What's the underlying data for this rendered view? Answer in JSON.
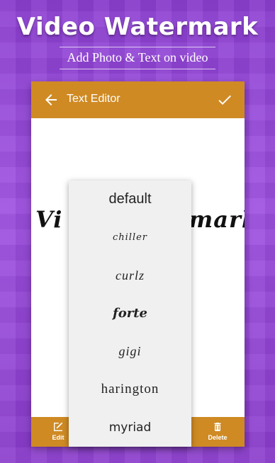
{
  "promo": {
    "title": "Video Watermark",
    "subtitle": "Add Photo & Text on video"
  },
  "toolbar": {
    "title": "Text Editor",
    "back_icon": "arrow-left-icon",
    "confirm_icon": "check-icon"
  },
  "preview": {
    "text_left": "Vi",
    "text_right": "mark"
  },
  "font_menu": {
    "options": [
      "default",
      "chiller",
      "curlz",
      "forte",
      "gigi",
      "harington",
      "myriad"
    ]
  },
  "bottom_bar": {
    "edit_label": "Edit",
    "delete_label": "Delete"
  },
  "colors": {
    "accent": "#cf8a24",
    "background": "#9545d8",
    "menu_bg": "#f0f0f0"
  }
}
